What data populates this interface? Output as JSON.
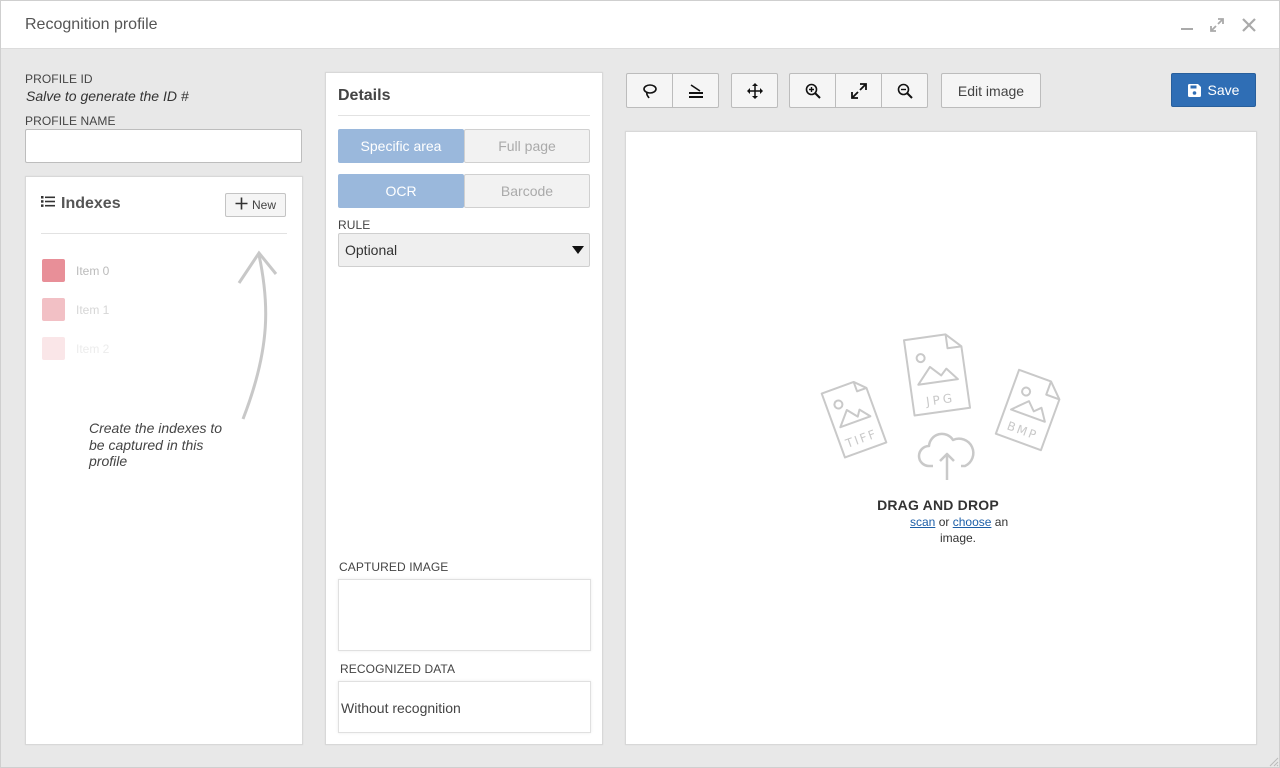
{
  "window": {
    "title": "Recognition profile"
  },
  "profile": {
    "id_label": "PROFILE ID",
    "id_value": "Salve to generate the ID #",
    "name_label": "PROFILE NAME",
    "name_value": "",
    "name_placeholder": ""
  },
  "indexes": {
    "title": "Indexes",
    "new_label": "New",
    "items": [
      {
        "label": "Item 0",
        "color": "#e88f98"
      },
      {
        "label": "Item 1",
        "color": "#f2c0c5"
      },
      {
        "label": "Item 2",
        "color": "#fae6e8"
      }
    ],
    "hint": "Create the indexes to be captured in this profile"
  },
  "details": {
    "title": "Details",
    "area_options": [
      "Specific area",
      "Full page"
    ],
    "area_selected": "Specific area",
    "mode_options": [
      "OCR",
      "Barcode"
    ],
    "mode_selected": "OCR",
    "rule_label": "RULE",
    "rule_value": "Optional",
    "captured_label": "CAPTURED IMAGE",
    "recognized_label": "RECOGNIZED DATA",
    "recognized_value": "Without recognition"
  },
  "toolbar": {
    "icons": [
      "lasso-icon",
      "scanner-icon",
      "move-icon",
      "zoom-in-icon",
      "fit-icon",
      "zoom-out-icon"
    ],
    "edit_label": "Edit image",
    "save_label": "Save"
  },
  "dropzone": {
    "title": "DRAG AND DROP",
    "scan_link": "scan",
    "or_text": "or",
    "choose_link": "choose",
    "an_text": "an",
    "image_text": "image.",
    "file_labels": [
      "TIFF",
      "JPG",
      "BMP"
    ]
  },
  "colors": {
    "accent": "#2f6eb5",
    "segment_active": "#9ab8dc"
  }
}
